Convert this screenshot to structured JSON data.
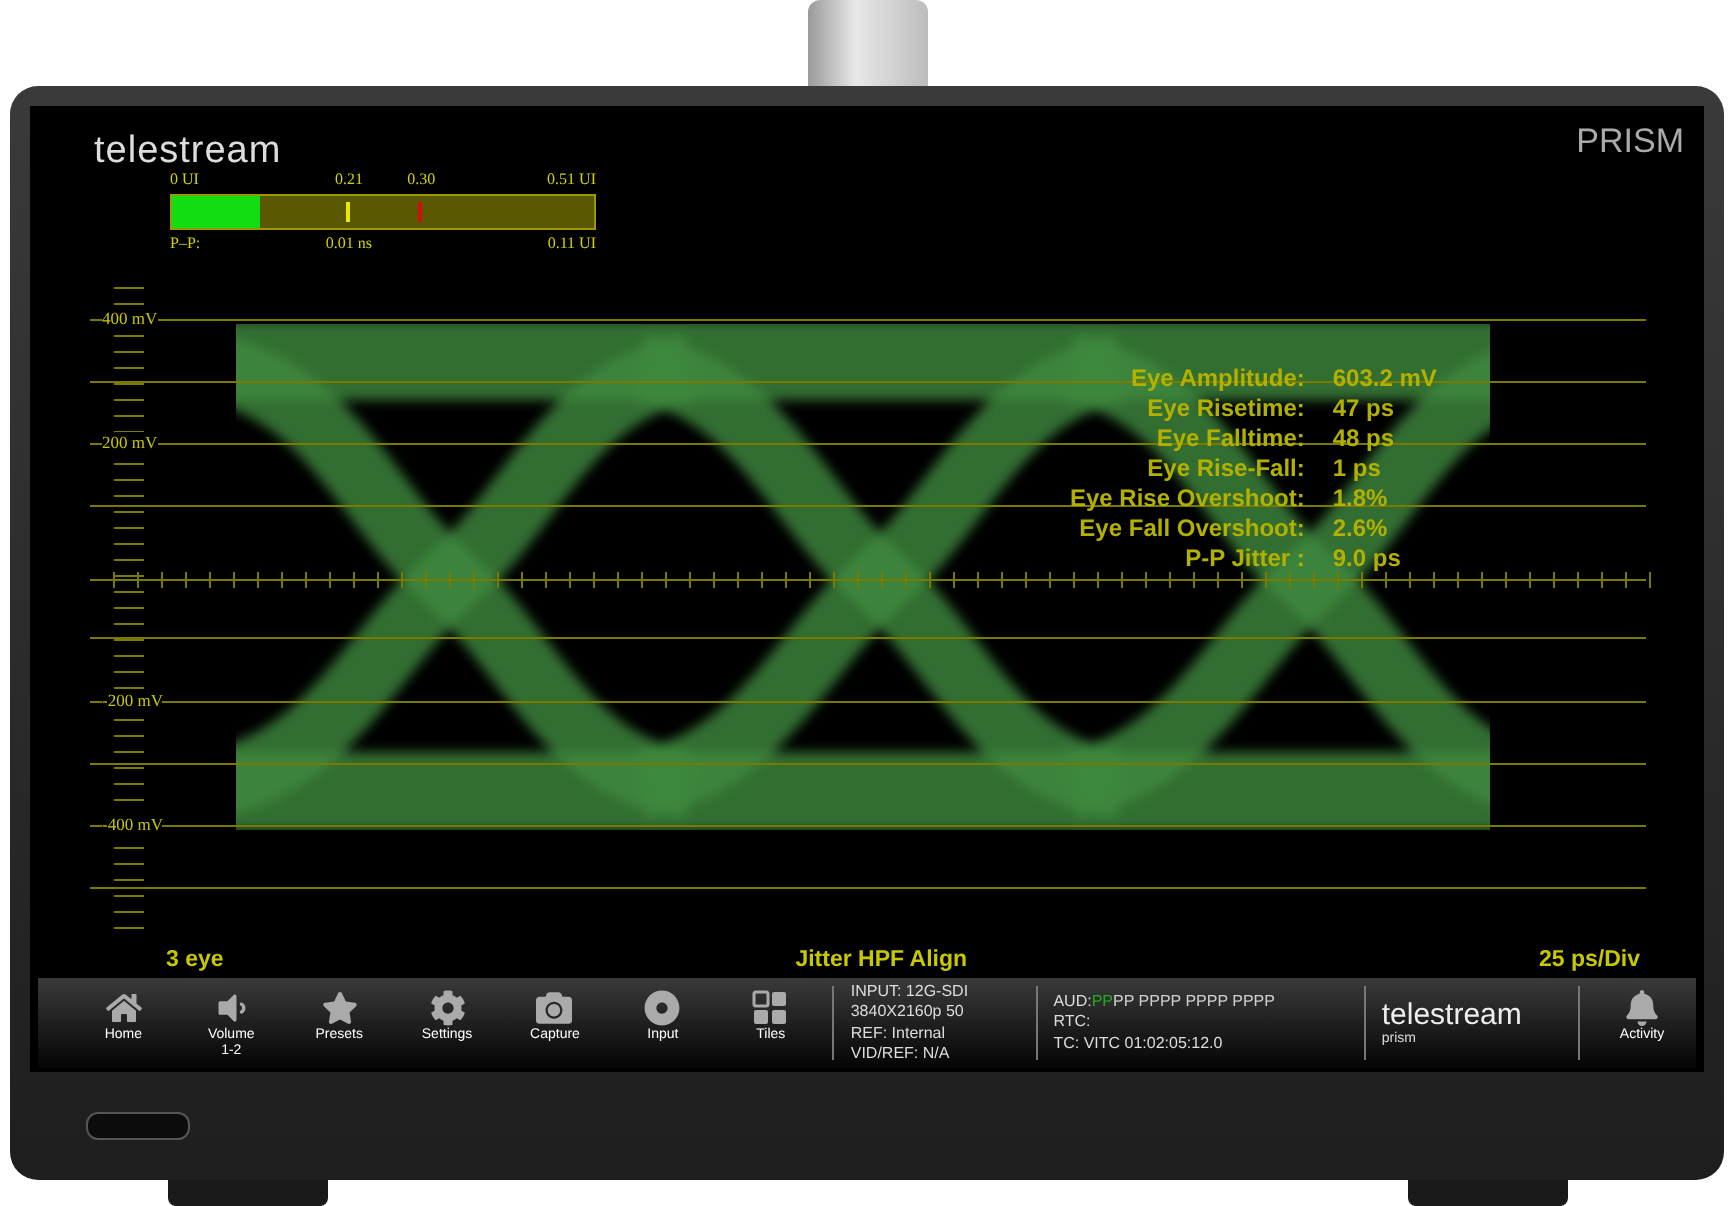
{
  "header": {
    "logo": "telestream",
    "product": "PRISM"
  },
  "jitter_meter": {
    "scale_labels": [
      "0 UI",
      "0.21",
      "0.30",
      "0.51 UI"
    ],
    "level": 0.21,
    "readouts": [
      "P–P:",
      "0.01 ns",
      "0.11 UI"
    ]
  },
  "y_axis_labels": [
    "400 mV",
    "200 mV",
    "-200 mV",
    "-400 mV"
  ],
  "measurements": [
    {
      "label": "Eye Amplitude:",
      "value": "603.2 mV"
    },
    {
      "label": "Eye Risetime:",
      "value": "47 ps"
    },
    {
      "label": "Eye Falltime:",
      "value": "48 ps"
    },
    {
      "label": "Eye Rise-Fall:",
      "value": "1 ps"
    },
    {
      "label": "Eye Rise Overshoot:",
      "value": "1.8%"
    },
    {
      "label": "Eye Fall Overshoot:",
      "value": "2.6%"
    },
    {
      "label": "P-P Jitter :",
      "value": "9.0 ps"
    }
  ],
  "footer": {
    "left": "3 eye",
    "center": "Jitter HPF Align",
    "right": "25 ps/Div"
  },
  "nav": [
    {
      "kind": "home",
      "label": "Home"
    },
    {
      "kind": "volume",
      "label": "Volume",
      "sublabel": "1-2"
    },
    {
      "kind": "star",
      "label": "Presets"
    },
    {
      "kind": "gear",
      "label": "Settings"
    },
    {
      "kind": "camera",
      "label": "Capture"
    },
    {
      "kind": "disc",
      "label": "Input"
    },
    {
      "kind": "tiles",
      "label": "Tiles"
    }
  ],
  "status": {
    "input_lines": [
      "INPUT: 12G-SDI",
      "3840X2160p 50",
      "REF: Internal",
      "VID/REF: N/A"
    ],
    "audio": {
      "label": "AUD:",
      "groups": [
        {
          "text": "PP",
          "color": "#22a822"
        },
        {
          "text": "PP PPPP PPPP PPPP",
          "color": "#cfcfcf"
        }
      ]
    },
    "lines": [
      "RTC:",
      "TC: VITC 01:02:05:12.0"
    ]
  },
  "brand": {
    "logo": "telestream",
    "sub": "prism"
  },
  "activity": {
    "label": "Activity"
  }
}
